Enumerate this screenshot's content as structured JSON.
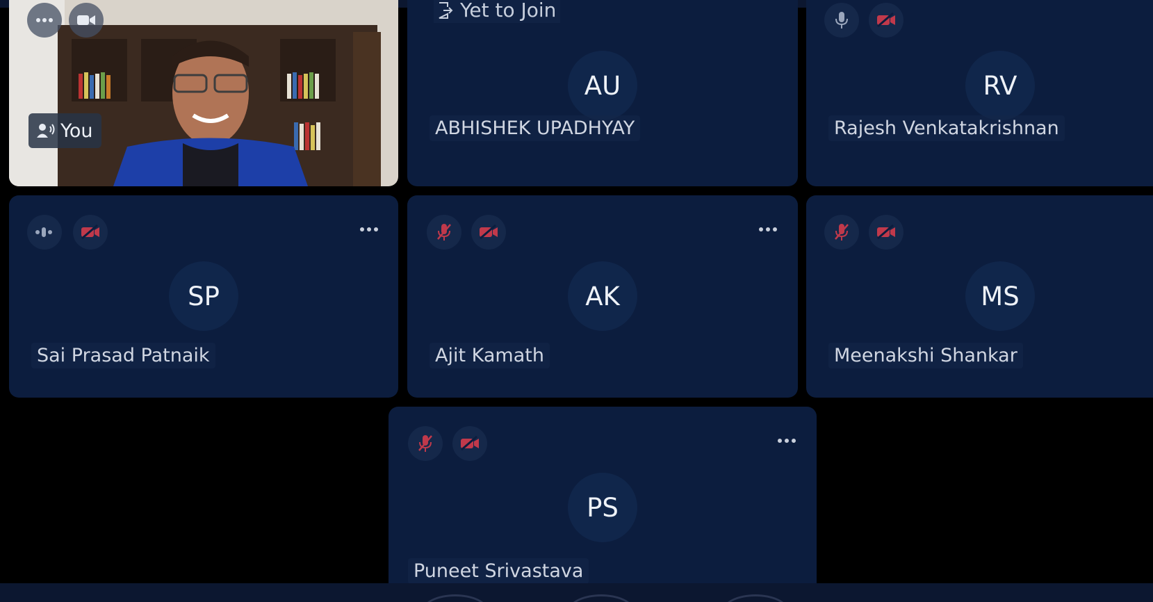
{
  "self": {
    "label": "You"
  },
  "status": {
    "yet_to_join": "Yet to Join"
  },
  "participants": [
    {
      "initials": "AU",
      "name": "ABHISHEK UPADHYAY"
    },
    {
      "initials": "RV",
      "name": "Rajesh Venkatakrishnan"
    },
    {
      "initials": "SP",
      "name": "Sai Prasad Patnaik"
    },
    {
      "initials": "AK",
      "name": "Ajit Kamath"
    },
    {
      "initials": "MS",
      "name": "Meenakshi Shankar"
    },
    {
      "initials": "PS",
      "name": "Puneet Srivastava"
    }
  ],
  "icons": {
    "mic": "mic-icon",
    "mic_muted": "mic-muted-icon",
    "camera_off": "camera-off-icon",
    "camera": "camera-icon",
    "more": "more-options-icon",
    "speaking": "speaking-indicator-icon",
    "exit_door": "yet-to-join-icon"
  },
  "colors": {
    "tile_bg": "#0c1d3e",
    "avatar_bg": "#10264b",
    "muted_red": "#c0394b",
    "page_bg": "#000000"
  }
}
